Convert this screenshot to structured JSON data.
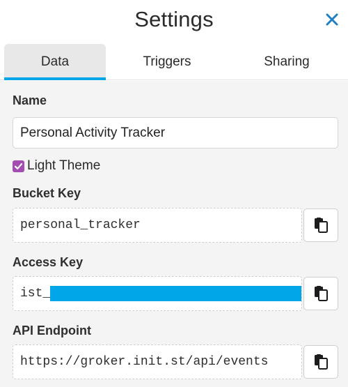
{
  "header": {
    "title": "Settings",
    "close_icon": "close-icon"
  },
  "tabs": [
    {
      "label": "Data",
      "active": true
    },
    {
      "label": "Triggers",
      "active": false
    },
    {
      "label": "Sharing",
      "active": false
    }
  ],
  "form": {
    "name_label": "Name",
    "name_value": "Personal Activity Tracker",
    "light_theme_label": "Light Theme",
    "light_theme_checked": true,
    "bucket_key_label": "Bucket Key",
    "bucket_key_value": "personal_tracker",
    "access_key_label": "Access Key",
    "access_key_prefix": "ist_",
    "api_endpoint_label": "API Endpoint",
    "api_endpoint_value": "https://groker.init.st/api/events"
  },
  "colors": {
    "accent": "#00a6e8",
    "checkbox": "#a34db2",
    "close_icon": "#1e7fc4"
  },
  "icons": {
    "copy": "clipboard-copy-icon",
    "check": "check-icon"
  }
}
